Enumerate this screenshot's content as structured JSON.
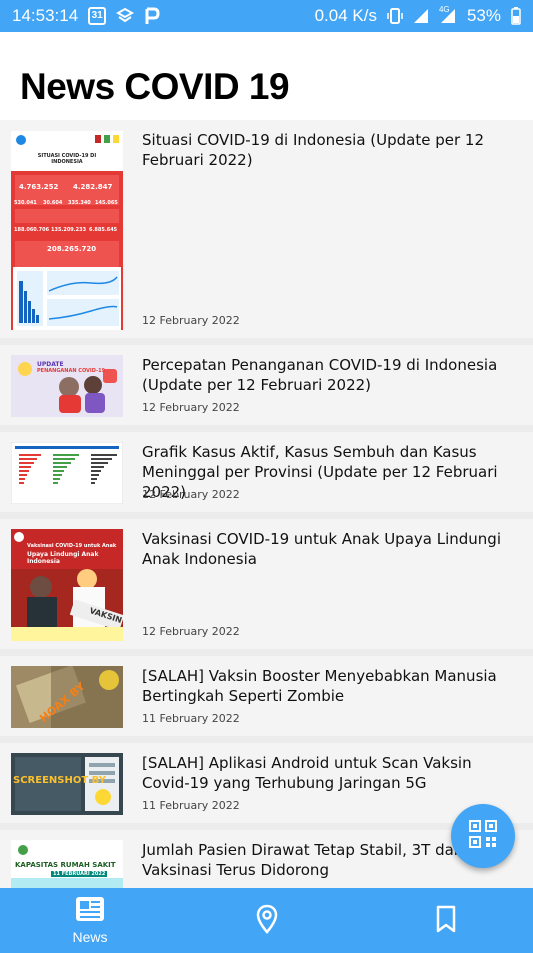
{
  "status_bar": {
    "time": "14:53:14",
    "calendar_day": "31",
    "network_speed": "0.04 K/s",
    "network_type": "4G",
    "battery": "53%"
  },
  "header": {
    "title": "News COVID 19"
  },
  "news": [
    {
      "title": "Situasi COVID-19 di Indonesia (Update per 12 Februari 2022)",
      "date": "12 February 2022"
    },
    {
      "title": "Percepatan Penanganan COVID-19 di Indonesia (Update per 12 Februari 2022)",
      "date": "12 February 2022"
    },
    {
      "title": "Grafik Kasus Aktif, Kasus Sembuh dan Kasus Meninggal per Provinsi (Update per 12 Februari 2022)",
      "date": "12 February 2022"
    },
    {
      "title": "Vaksinasi COVID-19 untuk Anak Upaya Lindungi Anak Indonesia",
      "date": "12 February 2022"
    },
    {
      "title": "[SALAH] Vaksin Booster Menyebabkan Manusia Bertingkah Seperti Zombie",
      "date": "11 February 2022"
    },
    {
      "title": "[SALAH] Aplikasi Android untuk Scan Vaksin Covid-19 yang Terhubung Jaringan 5G",
      "date": "11 February 2022"
    },
    {
      "title": "Jumlah Pasien Dirawat Tetap Stabil, 3T dan Vaksinasi Terus Didorong",
      "date": ""
    }
  ],
  "thumbs": {
    "situasi_title": "SITUASI COVID-19 DI INDONESIA",
    "situasi_n1": "4.763.252",
    "situasi_n2": "4.282.847",
    "situasi_n3": "530.041",
    "situasi_n4": "30.604",
    "situasi_n5": "335.340",
    "situasi_n6": "145.065",
    "situasi_n7": "188.060.706",
    "situasi_n8": "135.209.233",
    "situasi_n9": "6.885.645",
    "situasi_n10": "208.265.720",
    "update_label": "UPDATE",
    "penanganan_label": "PENANGANAN COVID-19",
    "vaksin_top": "Vaksinasi COVID-19 untuk Anak",
    "vaksin_mid": "Upaya Lindungi Anak Indonesia",
    "vaksin_sign": "VAKSIN",
    "hoax_stamp": "HOAX BY",
    "screenshot_label": "SCREENSHOT BY",
    "kapasitas_label": "KAPASITAS RUMAH SAKIT",
    "kapasitas_date": "11 FEBRUARI 2022"
  },
  "bottom_nav": {
    "news_label": "News"
  },
  "colors": {
    "primary": "#42a5f5",
    "card_bg": "#f4f4f4",
    "list_bg": "#ececec"
  }
}
